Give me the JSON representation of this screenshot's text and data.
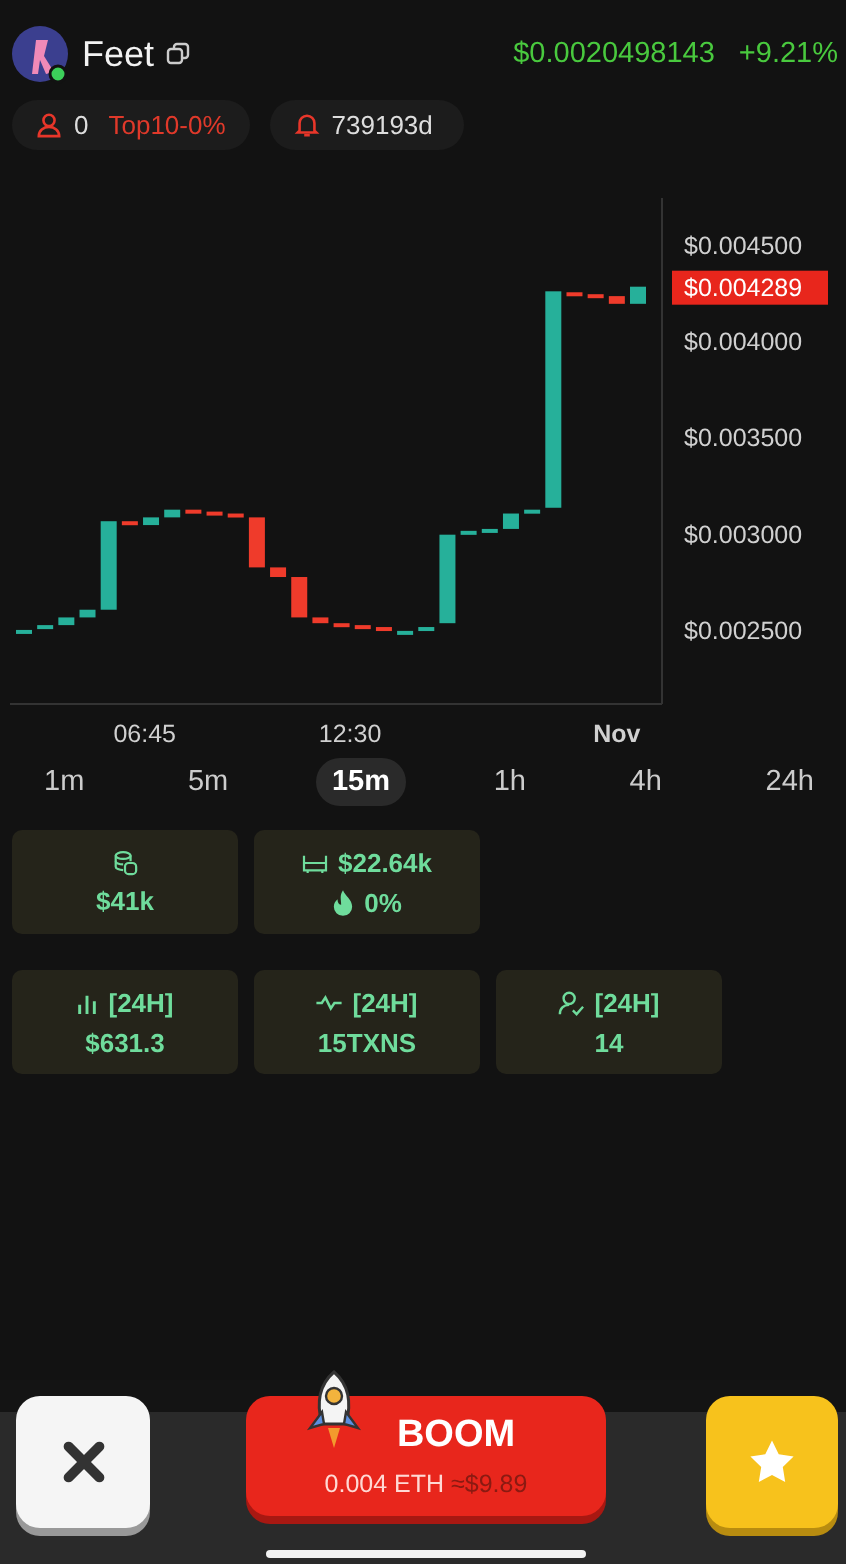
{
  "token": {
    "name": "Feet",
    "price": "$0.0020498143",
    "change": "+9.21%"
  },
  "pills": [
    {
      "kind": "holders",
      "count": "0",
      "tag": "Top10-0%"
    },
    {
      "kind": "age",
      "count": "739193d"
    }
  ],
  "chart": {
    "kind": "picture",
    "y_labels": [
      "$0.004500",
      "$0.004000",
      "$0.003500",
      "$0.003000",
      "$0.002500"
    ],
    "x_labels": [
      "06:45",
      "12:30",
      "Nov"
    ],
    "last_price": "$0.004289"
  },
  "intervals": [
    {
      "label": "1m",
      "selected": false
    },
    {
      "label": "5m",
      "selected": false
    },
    {
      "label": "15m",
      "selected": true
    },
    {
      "label": "1h",
      "selected": false
    },
    {
      "label": "4h",
      "selected": false
    },
    {
      "label": "24h",
      "selected": false
    }
  ],
  "stats_top": [
    {
      "kind": "liquidity",
      "lines": [
        "$41k"
      ]
    },
    {
      "kind": "pool",
      "lines": [
        "$22.64k",
        "0%"
      ]
    }
  ],
  "stats_24h": [
    {
      "kind": "volume",
      "period": "[24H]",
      "value": "$631.3"
    },
    {
      "kind": "txns",
      "period": "[24H]",
      "value": "15TXNS"
    },
    {
      "kind": "traders",
      "period": "[24H]",
      "value": "14"
    }
  ],
  "action": {
    "label": "BOOM",
    "amount": "0.004 ETH",
    "usd": "≈$9.89"
  }
}
